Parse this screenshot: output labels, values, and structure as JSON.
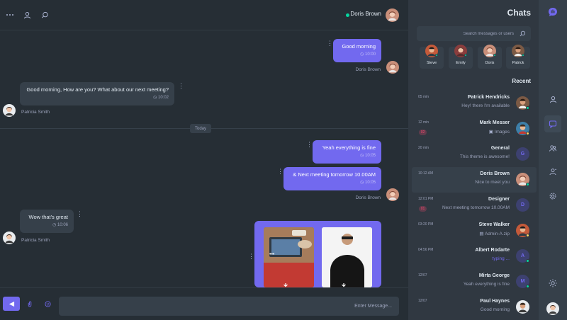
{
  "app": {
    "title": "Chats",
    "accent": "#7269ef",
    "online_color": "#06d6a0",
    "away_color": "#ffd166"
  },
  "conversation": {
    "header": {
      "name": "Doris Brown",
      "status": "online",
      "icons": [
        "more-icon",
        "user-icon",
        "search-icon"
      ]
    },
    "messages": [
      {
        "direction": "out",
        "text": "Good morning",
        "time": "10:00",
        "sender": "Doris Brown"
      },
      {
        "direction": "in",
        "text": "Good morning, How are you? What about our next meeting?",
        "time": "10:02",
        "sender": "Patricia Smith"
      },
      {
        "direction": "out",
        "text": "Yeah everything is fine",
        "time": "10:05"
      },
      {
        "direction": "out",
        "text": "& Next meeting tomorrow 10.00AM",
        "time": "10:05",
        "sender": "Doris Brown"
      },
      {
        "direction": "in",
        "text": "Wow that's great",
        "time": "10:06",
        "sender": "Patricia Smith"
      }
    ],
    "day_divider": "Today",
    "composer": {
      "placeholder": "Enter Message...",
      "icons": [
        "emoji-icon",
        "attachment-icon",
        "send-icon"
      ]
    }
  },
  "sidebar": {
    "search_placeholder": "Search messages or users",
    "online_users": [
      {
        "name": "Patrick"
      },
      {
        "name": "Doris"
      },
      {
        "name": "Emily"
      },
      {
        "name": "Steve"
      }
    ],
    "recent_label": "Recent",
    "chats": [
      {
        "name": "Patrick Hendricks",
        "message": "Hey! there I'm available",
        "time": "05 min",
        "status": "online",
        "avatar": "photo"
      },
      {
        "name": "Mark Messer",
        "message": "Images",
        "time": "12 min",
        "badge": "02",
        "status": "away",
        "avatar": "photo",
        "attachment": "image-icon"
      },
      {
        "name": "General",
        "message": "This theme is awesome!",
        "time": "20 min",
        "avatar_letter": "G"
      },
      {
        "name": "Doris Brown",
        "message": "Nice to meet you",
        "time": "10:12 AM",
        "status": "online",
        "avatar": "photo",
        "active": true
      },
      {
        "name": "Designer",
        "message": "Next meeting tomorrow 10.00AM",
        "time": "12:01 PM",
        "badge": "01",
        "avatar_letter": "D"
      },
      {
        "name": "Steve Walker",
        "message": "Admin-A.zip",
        "time": "03:20 PM",
        "status": "away",
        "avatar": "photo",
        "attachment": "file-icon"
      },
      {
        "name": "Albert Rodarte",
        "message": "typing ...",
        "time": "04:56 PM",
        "status": "online",
        "avatar_letter": "A",
        "typing": true
      },
      {
        "name": "Mirta George",
        "message": "Yeah everything is fine",
        "time": "12/07",
        "status": "online",
        "avatar_letter": "M"
      },
      {
        "name": "Paul Haynes",
        "message": "Good morning",
        "time": "12/07",
        "avatar": "photo"
      }
    ]
  },
  "nav_rail": {
    "items": [
      "logo-icon",
      "profile-icon",
      "chats-icon",
      "groups-icon",
      "contacts-icon",
      "settings-icon",
      "theme-toggle-icon",
      "user-avatar"
    ],
    "active": "chats-icon"
  }
}
